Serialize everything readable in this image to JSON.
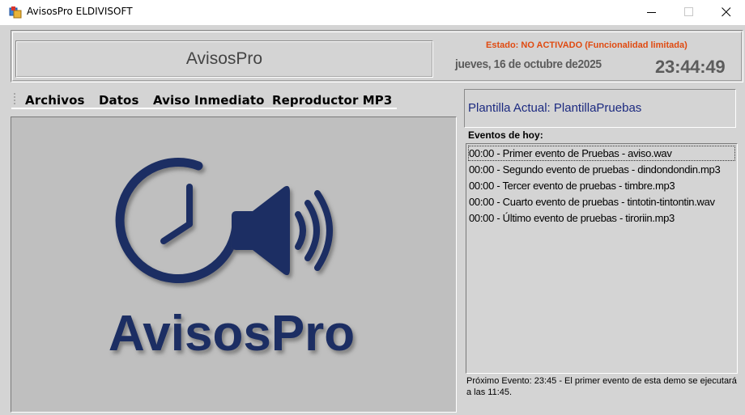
{
  "window": {
    "title": "AvisosPro ELDIVISOFT"
  },
  "header": {
    "brand_title": "AvisosPro",
    "estado": "Estado: NO ACTIVADO (Funcionalidad limitada)",
    "fecha": "jueves, 16 de octubre de2025",
    "hora": "23:44:49",
    "estado_color": "#e04a10"
  },
  "menu": {
    "items": [
      "Archivos",
      "Datos",
      "Aviso Inmediato",
      "Reproductor MP3"
    ]
  },
  "logo": {
    "text": "AvisosPro",
    "color": "#1a2d63"
  },
  "plantilla": {
    "label": "Plantilla Actual: PlantillaPruebas",
    "color": "#1c2a80"
  },
  "eventos": {
    "label": "Eventos de hoy:",
    "items": [
      "00:00 - Primer evento de Pruebas - aviso.wav",
      "00:00 - Segundo evento de pruebas - dindondondin.mp3",
      "00:00 - Tercer evento de pruebas - timbre.mp3",
      "00:00 - Cuarto evento de pruebas - tintotin-tintontin.wav",
      "00:00 - Último evento de pruebas - tiroriin.mp3"
    ]
  },
  "proximo": {
    "text": "Próximo Evento: 23:45 - El primer evento de esta demo se ejecutará a las 11:45."
  },
  "icons": {
    "app": "app-window-icon",
    "minimize": "minimize-icon",
    "maximize": "maximize-icon",
    "close": "close-icon",
    "logo_clock": "clock-icon",
    "logo_speaker": "speaker-icon"
  }
}
